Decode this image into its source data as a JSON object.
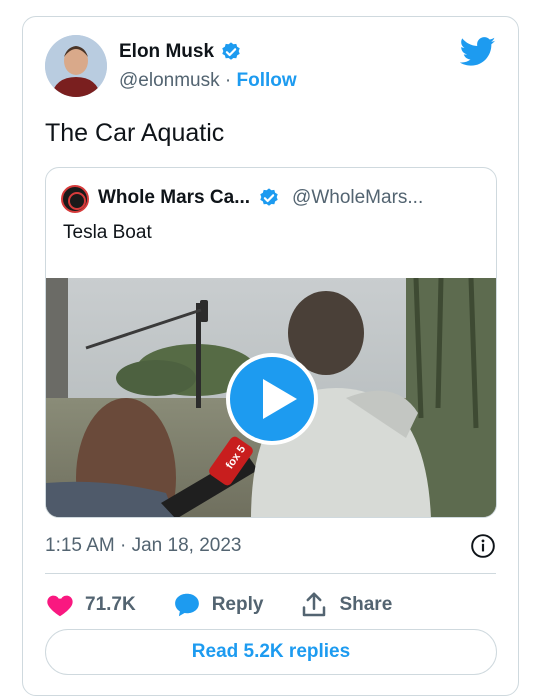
{
  "author": {
    "name": "Elon Musk",
    "handle": "@elonmusk",
    "separator": "·",
    "follow_label": "Follow"
  },
  "tweet": {
    "text": "The Car Aquatic",
    "timestamp": "1:15 AM · Jan 18, 2023"
  },
  "quoted": {
    "name": "Whole Mars Ca...",
    "handle": "@WholeMars...",
    "text": "Tesla Boat",
    "media_badge": "fox 5"
  },
  "actions": {
    "likes": "71.7K",
    "reply_label": "Reply",
    "share_label": "Share",
    "read_replies_label": "Read 5.2K replies"
  },
  "icons": {
    "brand": "twitter-bird-icon",
    "verified": "verified-badge-icon",
    "heart": "heart-icon",
    "reply": "reply-bubble-icon",
    "share": "share-upload-icon",
    "info": "info-icon",
    "play": "play-icon"
  },
  "colors": {
    "accent": "#1d9bf0",
    "heart": "#f91880",
    "text": "#0f1419",
    "muted": "#536471",
    "border": "#cfd9de"
  }
}
